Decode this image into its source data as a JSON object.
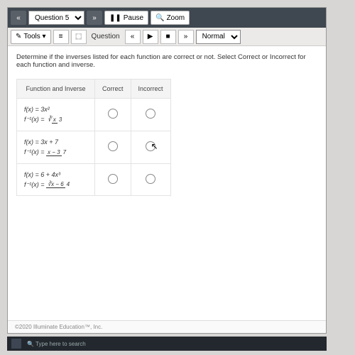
{
  "topbar": {
    "prev_glyph": "«",
    "question_select": "Question 5",
    "next_glyph": "»",
    "pause_label": "Pause",
    "pause_icon": "❚❚",
    "zoom_label": "Zoom",
    "zoom_icon": "🔍"
  },
  "secbar": {
    "tools_label": "Tools ▾",
    "icon1": "≡",
    "icon2": "⬚",
    "question_label": "Question",
    "nav_prev": "«",
    "nav_play": "▶",
    "nav_stop": "■",
    "nav_next": "»",
    "mode_select": "Normal"
  },
  "prompt": "Determine if the inverses listed for each function are correct or not. Select Correct or Incorrect for each function and inverse.",
  "table": {
    "headers": {
      "fn": "Function and Inverse",
      "correct": "Correct",
      "incorrect": "Incorrect"
    },
    "rows": [
      {
        "f": "f(x) = 3x²",
        "finv": "f⁻¹(x) = ∛(x/3)"
      },
      {
        "f": "f(x) = 3x + 7",
        "finv": "f⁻¹(x) = (x − 3) / 7"
      },
      {
        "f": "f(x) = 6 + 4x³",
        "finv": "f⁻¹(x) = (∛x − 6) / 4"
      }
    ]
  },
  "footer": "©2020  Illuminate Education™, Inc.",
  "taskbar_hint": "Type here to search"
}
